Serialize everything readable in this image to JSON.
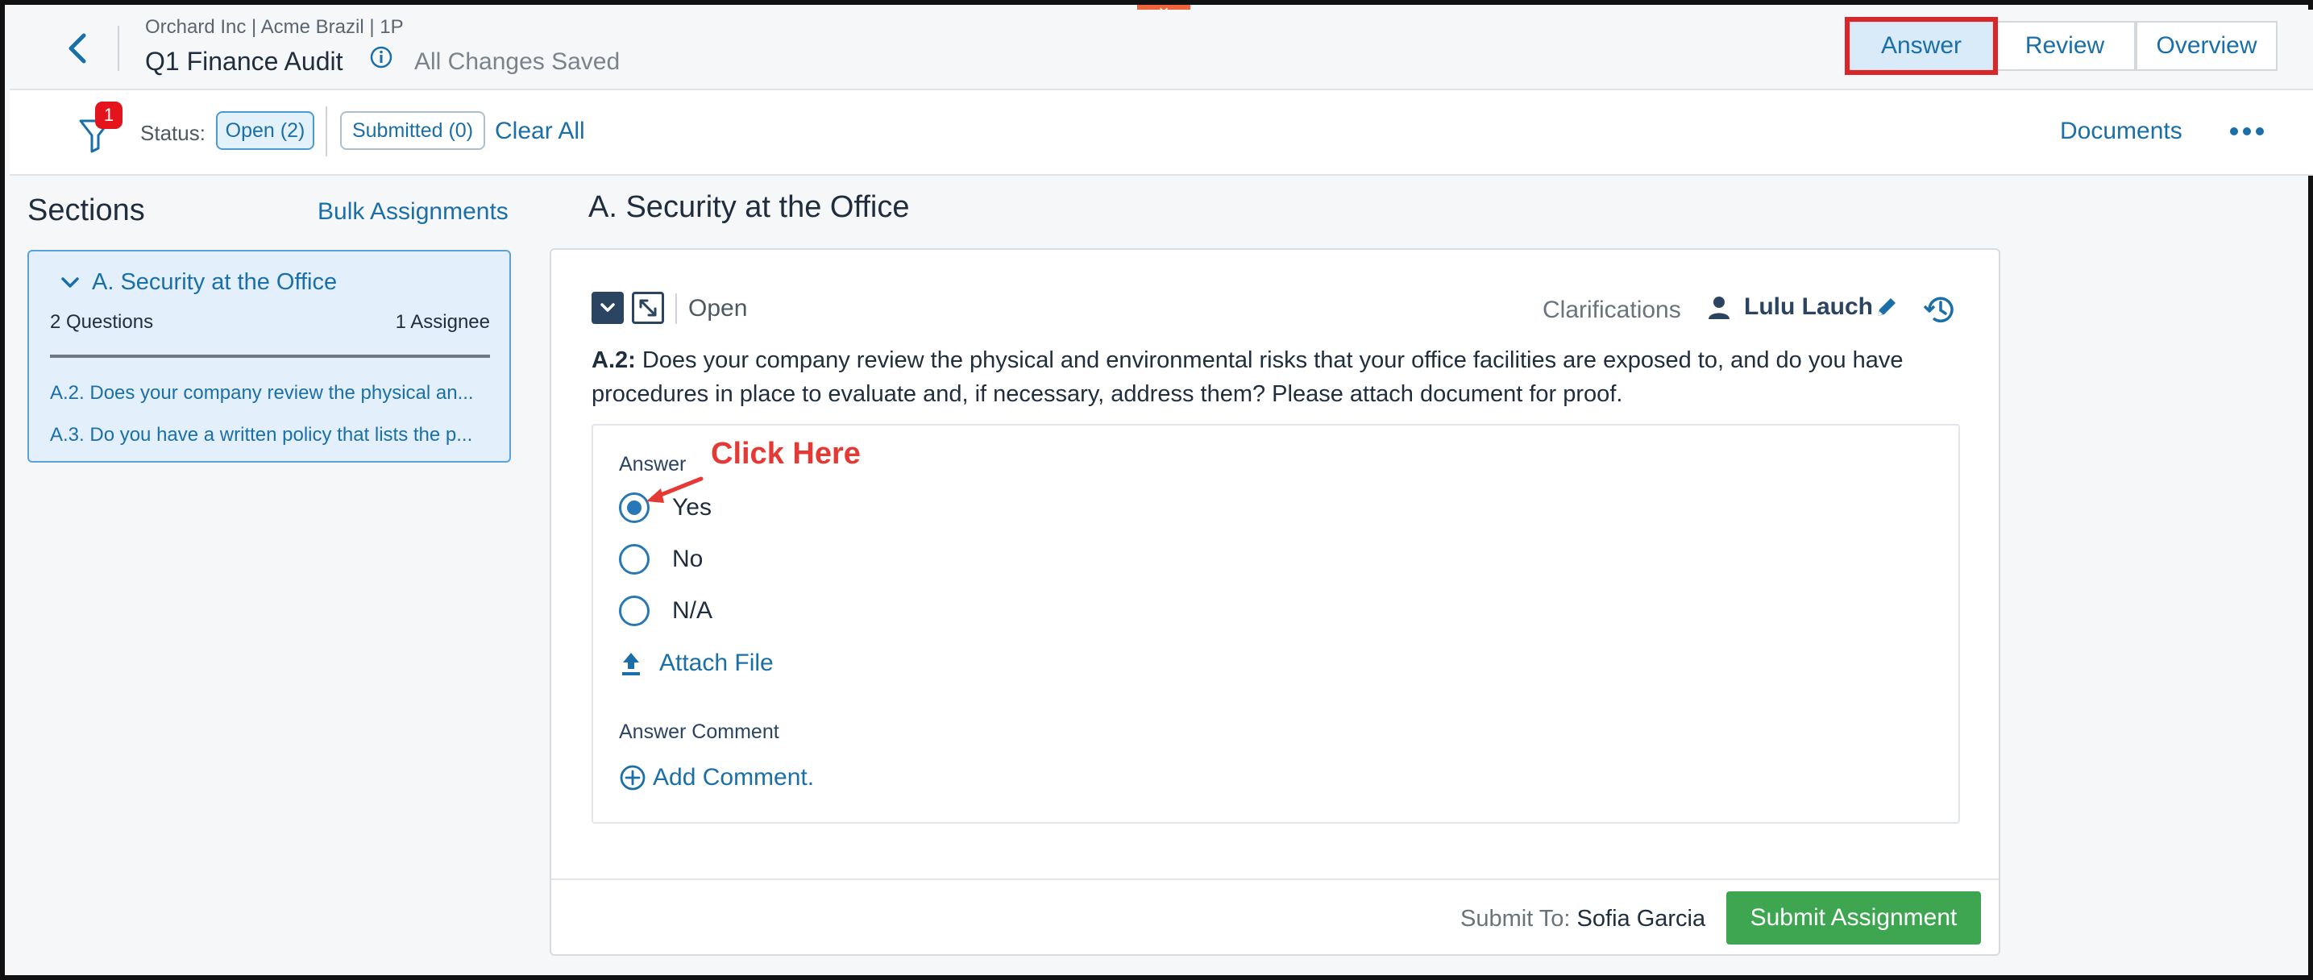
{
  "header": {
    "breadcrumb": "Orchard Inc | Acme Brazil | 1P",
    "title": "Q1 Finance Audit",
    "saved_status": "All Changes Saved",
    "tabs": [
      {
        "label": "Answer",
        "active": true
      },
      {
        "label": "Review",
        "active": false
      },
      {
        "label": "Overview",
        "active": false
      }
    ]
  },
  "filter_bar": {
    "filter_badge": "1",
    "status_label": "Status:",
    "open_pill": "Open (2)",
    "submitted_pill": "Submitted (0)",
    "clear_all": "Clear All",
    "documents": "Documents"
  },
  "sections": {
    "title": "Sections",
    "bulk_assignments": "Bulk Assignments",
    "current": {
      "name": "A. Security at the Office",
      "questions_count": "2 Questions",
      "assignee_count": "1 Assignee",
      "items": [
        "A.2. Does your company review the physical an...",
        "A.3. Do you have a written policy that lists the p..."
      ]
    }
  },
  "main": {
    "section_title": "A. Security at the Office",
    "question": {
      "status": "Open",
      "clarifications": "Clarifications",
      "assignee": "Lulu Lauch",
      "number": "A.2:",
      "text": " Does your company review the physical and environmental risks that your office facilities are exposed to, and do you have procedures in place to evaluate and, if necessary, address them? Please attach document for proof.",
      "answer_label": "Answer",
      "options": [
        {
          "label": "Yes",
          "checked": true
        },
        {
          "label": "No",
          "checked": false
        },
        {
          "label": "N/A",
          "checked": false
        }
      ],
      "attach_file": "Attach File",
      "answer_comment_label": "Answer Comment",
      "add_comment": "Add Comment."
    },
    "annotation": "Click Here",
    "footer": {
      "submit_to_label": "Submit To:",
      "submit_to_name": "Sofia Garcia",
      "submit_button": "Submit Assignment"
    }
  },
  "colors": {
    "accent": "#1a6fa8",
    "submit_green": "#3ea650",
    "highlight_red": "#d8262b"
  }
}
